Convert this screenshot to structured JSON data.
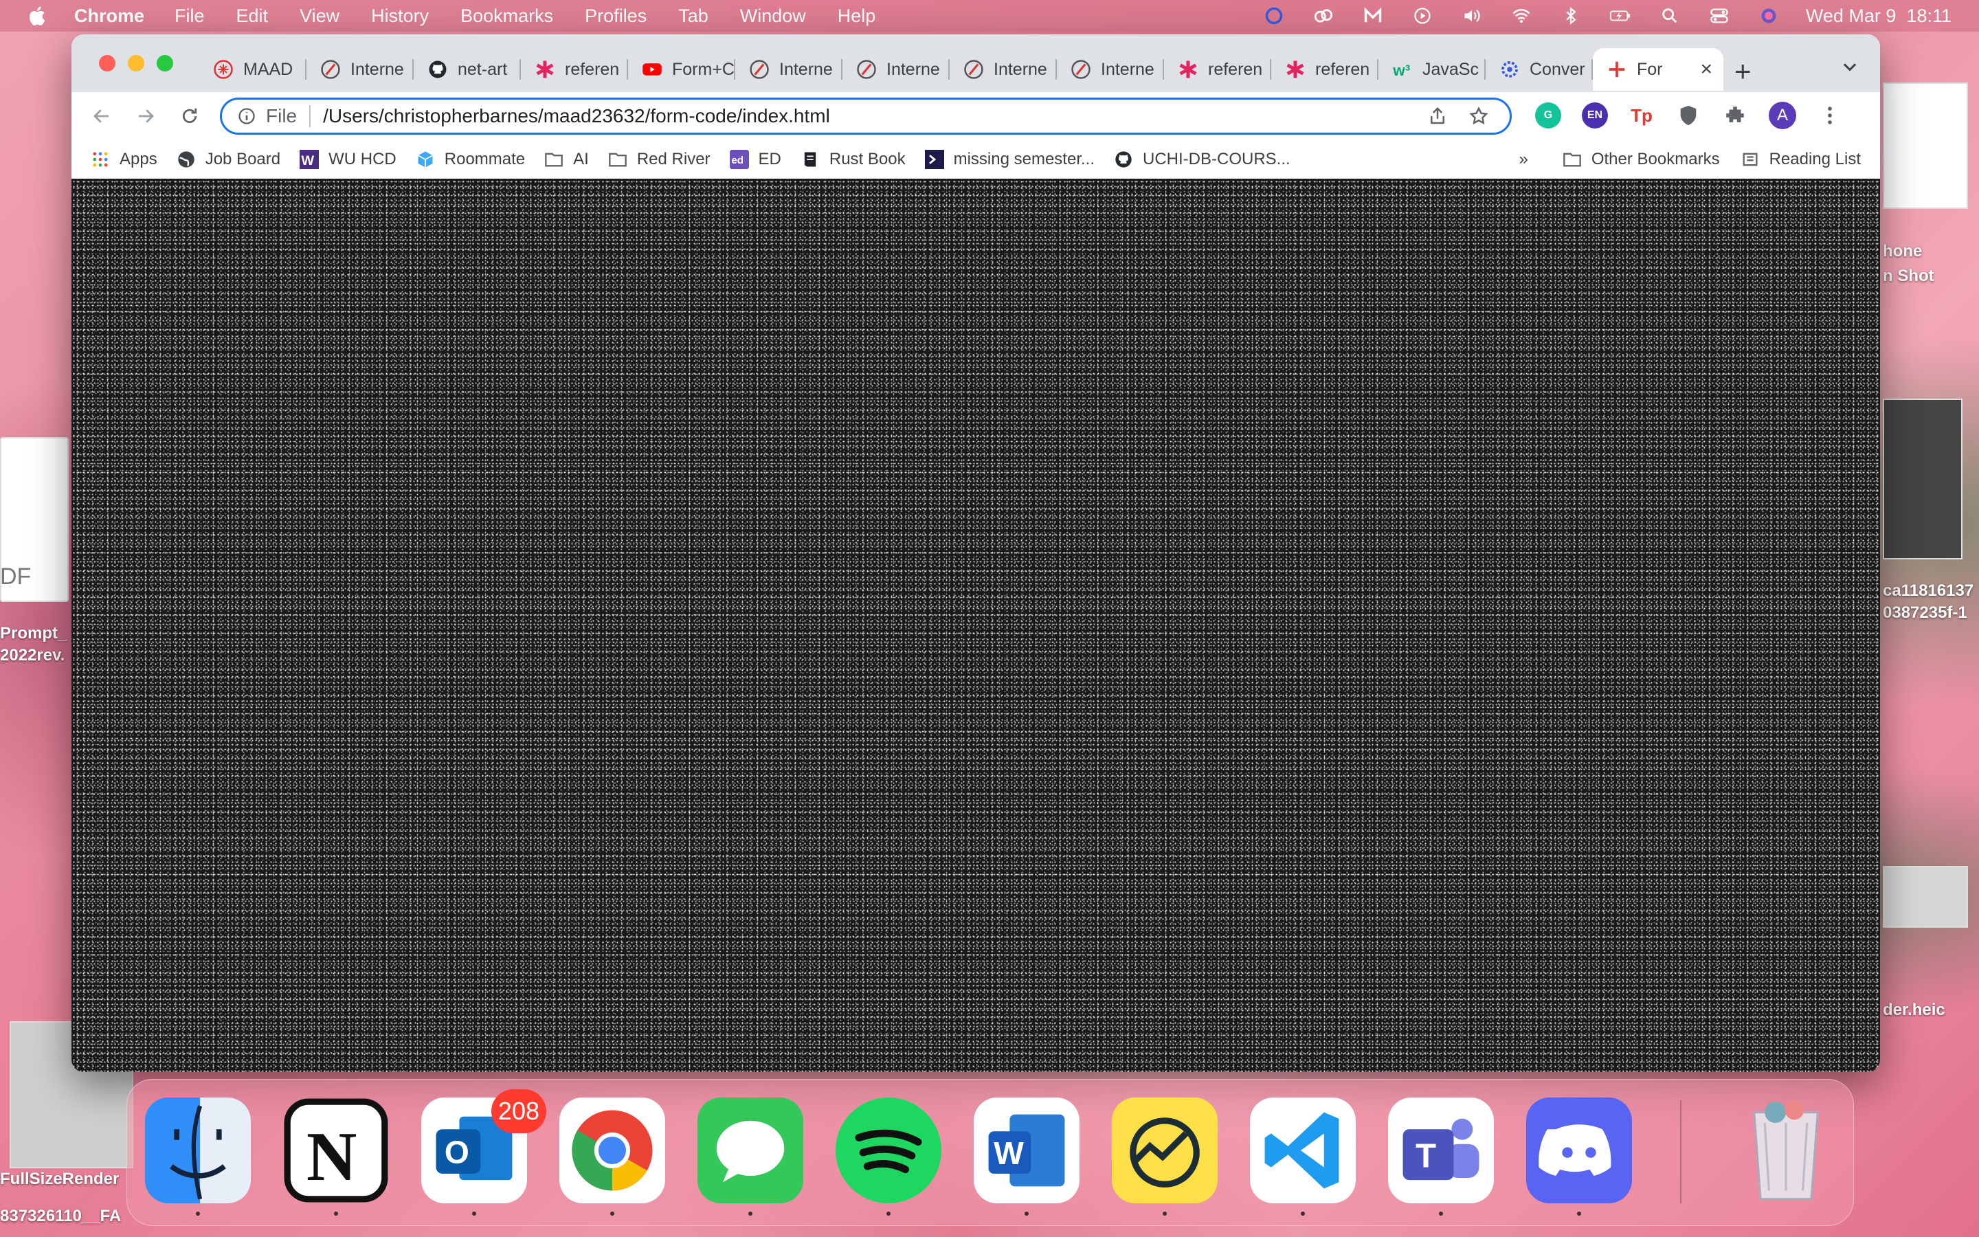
{
  "menubar": {
    "app_name": "Chrome",
    "items": [
      "File",
      "Edit",
      "View",
      "History",
      "Bookmarks",
      "Profiles",
      "Tab",
      "Window",
      "Help"
    ],
    "clock": "Wed Mar 9  18:11"
  },
  "browser": {
    "tabs": [
      {
        "label": "MAAD",
        "icon": "maad-icon"
      },
      {
        "label": "Interne",
        "icon": "internet-icon"
      },
      {
        "label": "net-art",
        "icon": "github-icon"
      },
      {
        "label": "referen",
        "icon": "asterisk-icon"
      },
      {
        "label": "Form+C",
        "icon": "youtube-icon"
      },
      {
        "label": "Interne",
        "icon": "internet-icon"
      },
      {
        "label": "Interne",
        "icon": "internet-icon"
      },
      {
        "label": "Interne",
        "icon": "internet-icon"
      },
      {
        "label": "Interne",
        "icon": "internet-icon"
      },
      {
        "label": "referen",
        "icon": "asterisk-icon"
      },
      {
        "label": "referen",
        "icon": "asterisk-icon"
      },
      {
        "label": "JavaSc",
        "icon": "w3-icon"
      },
      {
        "label": "Conver",
        "icon": "gear-icon"
      }
    ],
    "active_tab": {
      "label": "For",
      "close": "×"
    },
    "new_tab": "+",
    "omnibox": {
      "scheme": "File",
      "url": "/Users/christopherbarnes/maad23632/form-code/index.html"
    },
    "profile_initial": "A",
    "extensions": [
      "G",
      "EN",
      "Tp"
    ]
  },
  "bookmarks": {
    "items": [
      {
        "label": "Apps",
        "icon": "apps-grid-icon"
      },
      {
        "label": "Job Board",
        "icon": "globe-icon"
      },
      {
        "label": "WU HCD",
        "icon": "w-icon"
      },
      {
        "label": "Roommate",
        "icon": "cube-icon"
      },
      {
        "label": "AI",
        "icon": "folder-icon"
      },
      {
        "label": "Red River",
        "icon": "folder-icon"
      },
      {
        "label": "ED",
        "icon": "ed-icon"
      },
      {
        "label": "Rust Book",
        "icon": "book-icon"
      },
      {
        "label": "missing semester...",
        "icon": "terminal-icon"
      },
      {
        "label": "UCHI-DB-COURS...",
        "icon": "github-icon"
      }
    ],
    "overflow": "»",
    "other": "Other Bookmarks",
    "reading_list": "Reading List"
  },
  "desktop": {
    "right_labels": [
      "hone",
      "n Shot",
      "ca11816137",
      "0387235f-1",
      "der.heic"
    ],
    "left_labels": [
      "Prompt_",
      "2022rev.",
      "DF",
      "FullSizeRender",
      "837326110__FA"
    ]
  },
  "dock": {
    "apps": [
      {
        "name": "Finder",
        "icon": "finder-icon"
      },
      {
        "name": "Notion",
        "icon": "notion-icon"
      },
      {
        "name": "Outlook",
        "icon": "outlook-icon",
        "badge": "208"
      },
      {
        "name": "Chrome",
        "icon": "chrome-icon"
      },
      {
        "name": "Messages",
        "icon": "messages-icon"
      },
      {
        "name": "Spotify",
        "icon": "spotify-icon"
      },
      {
        "name": "Word",
        "icon": "word-icon"
      },
      {
        "name": "Basecamp",
        "icon": "basecamp-icon"
      },
      {
        "name": "VS Code",
        "icon": "vscode-icon"
      },
      {
        "name": "Teams",
        "icon": "teams-icon"
      },
      {
        "name": "Discord",
        "icon": "discord-icon"
      },
      {
        "name": "Trash",
        "icon": "trash-icon"
      }
    ]
  }
}
